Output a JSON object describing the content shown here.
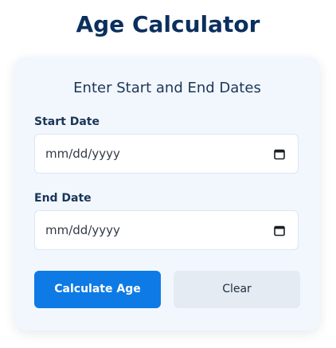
{
  "app": {
    "title": "Age Calculator"
  },
  "card": {
    "heading": "Enter Start and End Dates"
  },
  "form": {
    "start_date": {
      "label": "Start Date",
      "placeholder": "mm/dd/yyyy",
      "value": ""
    },
    "end_date": {
      "label": "End Date",
      "placeholder": "mm/dd/yyyy",
      "value": ""
    }
  },
  "buttons": {
    "calculate_label": "Calculate Age",
    "clear_label": "Clear"
  },
  "icons": {
    "date_picker": "calendar-icon"
  },
  "colors": {
    "title": "#0b2f5e",
    "primary_button": "#0d7ae6",
    "secondary_button": "#e4ebf3",
    "card_background": "#f2f7fe"
  }
}
